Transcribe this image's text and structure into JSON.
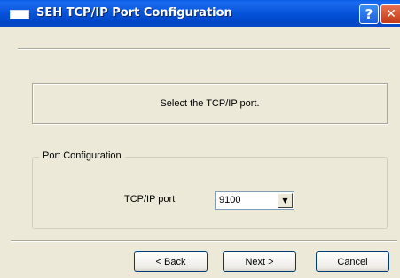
{
  "window": {
    "title": "SEH TCP/IP Port Configuration",
    "help_glyph": "?",
    "close_glyph": "✕"
  },
  "info": {
    "text": "Select the TCP/IP port."
  },
  "port_config": {
    "legend": "Port Configuration",
    "tcpip_port_label": "TCP/IP port",
    "tcpip_port_value": "9100",
    "dropdown_glyph": "▼"
  },
  "footer": {
    "back_label": "< Back",
    "next_label": "Next >",
    "cancel_label": "Cancel"
  }
}
